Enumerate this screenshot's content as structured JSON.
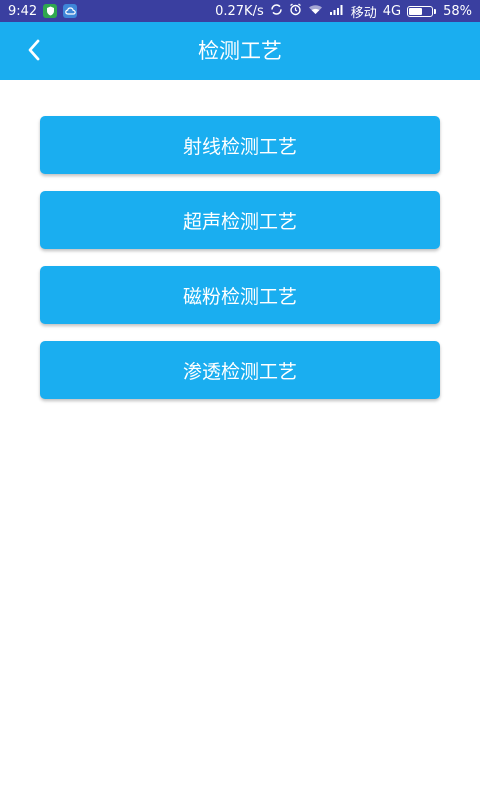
{
  "status_bar": {
    "time": "9:42",
    "speed": "0.27K/s",
    "carrier": "移动",
    "network": "4G",
    "battery_level": 0.58,
    "battery_text": "58%"
  },
  "app_bar": {
    "title": "检测工艺",
    "back_icon": "chevron-left-icon"
  },
  "menu": {
    "items": [
      {
        "label": "射线检测工艺"
      },
      {
        "label": "超声检测工艺"
      },
      {
        "label": "磁粉检测工艺"
      },
      {
        "label": "渗透检测工艺"
      }
    ]
  },
  "colors": {
    "accent": "#1aaef0",
    "status_bar": "#3a3fa0",
    "background": "#ffffff"
  }
}
